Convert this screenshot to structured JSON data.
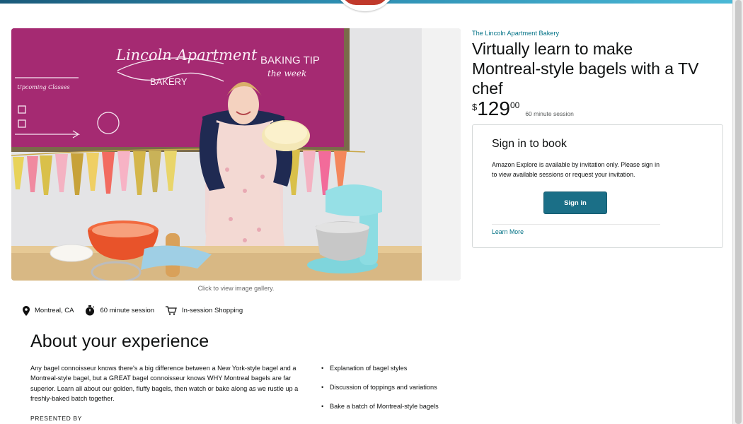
{
  "hero": {
    "gallery_caption": "Click to view image gallery.",
    "chalkboard": {
      "line1": "Lincoln Apartment",
      "line2": "BAKERY",
      "tip1": "BAKING TIP",
      "tip2": "the week",
      "side": "Upcoming Classes"
    }
  },
  "meta": {
    "location": "Montreal, CA",
    "duration": "60 minute session",
    "shopping": "In-session Shopping"
  },
  "about": {
    "title": "About your experience",
    "description": "Any bagel connoisseur knows there's a big difference between a New York-style bagel and a Montreal-style bagel, but a GREAT bagel connoisseur knows WHY Montreal bagels are far superior. Learn all about our golden, fluffy bagels, then watch or bake along as we rustle up a freshly-baked batch together.",
    "presented_by": "PRESENTED BY",
    "bullets": [
      "Explanation of bagel styles",
      "Discussion of toppings and variations",
      "Bake a batch of Montreal-style bagels"
    ]
  },
  "listing": {
    "seller": "The Lincoln Apartment Bakery",
    "title": "Virtually learn to make Montreal-style bagels with a TV chef",
    "price_symbol": "$",
    "price_whole": "129",
    "price_fraction": "00",
    "session": "60 minute session"
  },
  "signin": {
    "title": "Sign in to book",
    "text": "Amazon Explore is available by invitation only. Please sign in to view available sessions or request your invitation.",
    "button": "Sign in",
    "learn_more": "Learn More"
  },
  "colors": {
    "accent_teal": "#1b6f87",
    "link": "#007185",
    "chalkboard": "#a52a72"
  }
}
